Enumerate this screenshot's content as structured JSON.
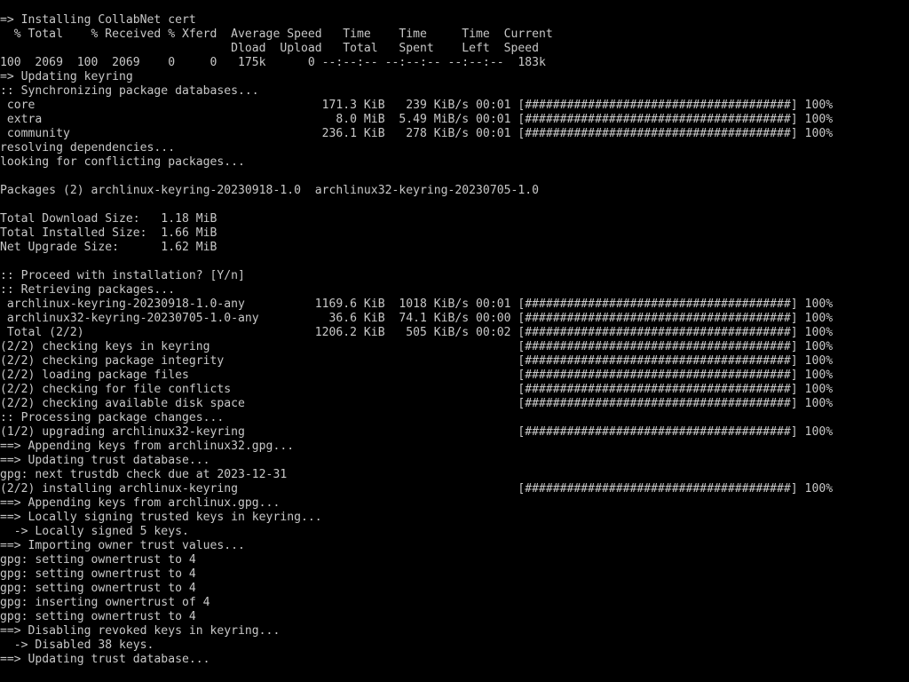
{
  "terminal": {
    "lines": [
      "=> Installing CollabNet cert",
      "  % Total    % Received % Xferd  Average Speed   Time    Time     Time  Current",
      "                                 Dload  Upload   Total   Spent    Left  Speed",
      "100  2069  100  2069    0     0   175k      0 --:--:-- --:--:-- --:--:--  183k",
      "=> Updating keyring",
      ":: Synchronizing package databases...",
      " core                                         171.3 KiB   239 KiB/s 00:01 [######################################] 100%",
      " extra                                          8.0 MiB  5.49 MiB/s 00:01 [######################################] 100%",
      " community                                    236.1 KiB   278 KiB/s 00:01 [######################################] 100%",
      "resolving dependencies...",
      "looking for conflicting packages...",
      "",
      "Packages (2) archlinux-keyring-20230918-1.0  archlinux32-keyring-20230705-1.0",
      "",
      "Total Download Size:   1.18 MiB",
      "Total Installed Size:  1.66 MiB",
      "Net Upgrade Size:      1.62 MiB",
      "",
      ":: Proceed with installation? [Y/n]",
      ":: Retrieving packages...",
      " archlinux-keyring-20230918-1.0-any          1169.6 KiB  1018 KiB/s 00:01 [######################################] 100%",
      " archlinux32-keyring-20230705-1.0-any          36.6 KiB  74.1 KiB/s 00:00 [######################################] 100%",
      " Total (2/2)                                 1206.2 KiB   505 KiB/s 00:02 [######################################] 100%",
      "(2/2) checking keys in keyring                                            [######################################] 100%",
      "(2/2) checking package integrity                                          [######################################] 100%",
      "(2/2) loading package files                                               [######################################] 100%",
      "(2/2) checking for file conflicts                                         [######################################] 100%",
      "(2/2) checking available disk space                                       [######################################] 100%",
      ":: Processing package changes...",
      "(1/2) upgrading archlinux32-keyring                                       [######################################] 100%",
      "==> Appending keys from archlinux32.gpg...",
      "==> Updating trust database...",
      "gpg: next trustdb check due at 2023-12-31",
      "(2/2) installing archlinux-keyring                                        [######################################] 100%",
      "==> Appending keys from archlinux.gpg...",
      "==> Locally signing trusted keys in keyring...",
      "  -> Locally signed 5 keys.",
      "==> Importing owner trust values...",
      "gpg: setting ownertrust to 4",
      "gpg: setting ownertrust to 4",
      "gpg: setting ownertrust to 4",
      "gpg: inserting ownertrust of 4",
      "gpg: setting ownertrust to 4",
      "==> Disabling revoked keys in keyring...",
      "  -> Disabled 38 keys.",
      "==> Updating trust database..."
    ]
  },
  "colors": {
    "background": "#000000",
    "text": "#c8c8c8"
  }
}
